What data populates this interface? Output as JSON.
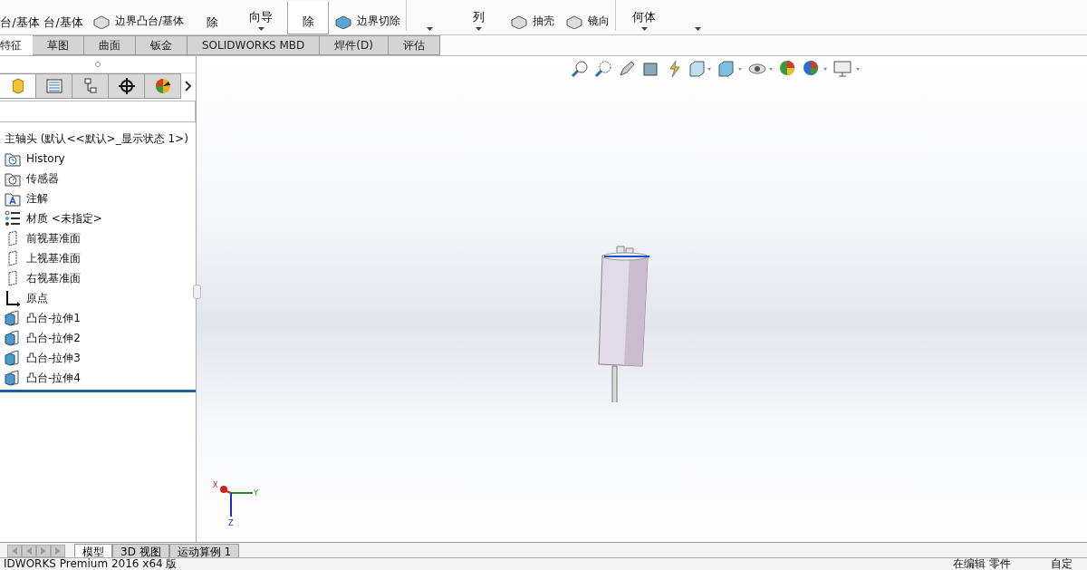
{
  "ribbon": {
    "items": [
      {
        "kind": "big",
        "label": "台/基体"
      },
      {
        "kind": "big",
        "label": "台/基体"
      },
      {
        "kind": "small",
        "label": "边界凸台/基体"
      },
      {
        "kind": "big",
        "label": "除"
      },
      {
        "kind": "dropdown",
        "label": "向导"
      },
      {
        "kind": "bigsel",
        "label": "除"
      },
      {
        "kind": "small",
        "label": "边界切除"
      },
      {
        "kind": "dropdown"
      },
      {
        "kind": "dropdown",
        "label": "列"
      },
      {
        "kind": "small",
        "label": "抽壳"
      },
      {
        "kind": "small",
        "label": "镜向"
      },
      {
        "kind": "dropdown",
        "label": "何体"
      },
      {
        "kind": "dropdown"
      }
    ]
  },
  "panel_tabs": [
    {
      "selected": true
    },
    {
      "selected": false
    },
    {
      "selected": false
    },
    {
      "selected": false
    },
    {
      "selected": false
    }
  ],
  "command_tabs": [
    {
      "label": "特征",
      "selected": true
    },
    {
      "label": "草图",
      "selected": false
    },
    {
      "label": "曲面",
      "selected": false
    },
    {
      "label": "钣金",
      "selected": false
    },
    {
      "label": "SOLIDWORKS MBD",
      "selected": false
    },
    {
      "label": "焊件(D)",
      "selected": false
    },
    {
      "label": "评估",
      "selected": false
    }
  ],
  "feature_tree": {
    "root": "主轴头  (默认<<默认>_显示状态 1>)",
    "children": [
      {
        "kind": "history",
        "label": "History"
      },
      {
        "kind": "sensor",
        "label": "传感器"
      },
      {
        "kind": "annotation",
        "label": "注解"
      },
      {
        "kind": "material",
        "label": "材质 <未指定>"
      },
      {
        "kind": "plane",
        "label": "前视基准面"
      },
      {
        "kind": "plane",
        "label": "上视基准面"
      },
      {
        "kind": "plane",
        "label": "右视基准面"
      },
      {
        "kind": "origin",
        "label": "原点"
      },
      {
        "kind": "feature",
        "label": "凸台-拉伸1"
      },
      {
        "kind": "feature",
        "label": "凸台-拉伸2"
      },
      {
        "kind": "feature",
        "label": "凸台-拉伸3"
      },
      {
        "kind": "feature",
        "label": "凸台-拉伸4"
      }
    ]
  },
  "triad": {
    "x": "X",
    "y": "Y",
    "z": "Z"
  },
  "bottom_tabs": [
    {
      "label": "模型",
      "selected": true
    },
    {
      "label": "3D 视图",
      "selected": false
    },
    {
      "label": "运动算例 1",
      "selected": false
    }
  ],
  "status_bar": {
    "app": "IDWORKS Premium 2016 x64 版",
    "mode": "在编辑 零件",
    "units": "自定"
  }
}
